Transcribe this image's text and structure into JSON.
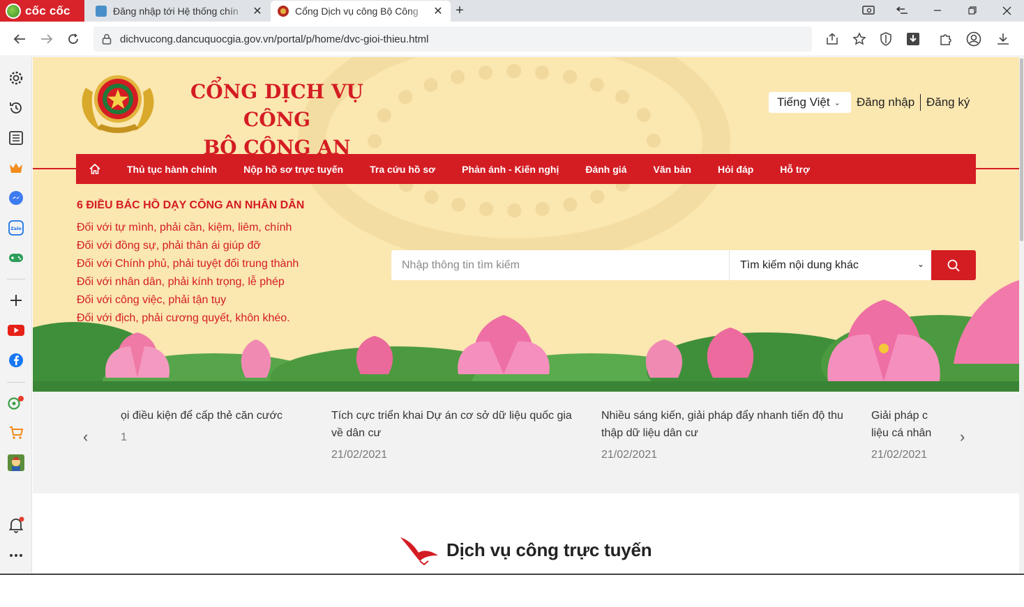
{
  "browser": {
    "brand": "cốc cốc",
    "tabs": [
      {
        "title": "Đăng nhập tới Hệ thống chín"
      },
      {
        "title": "Cổng Dịch vụ công Bộ Công"
      }
    ],
    "url": "dichvucong.dancuquocgia.gov.vn/portal/p/home/dvc-gioi-thieu.html"
  },
  "header": {
    "title_line1": "CỔNG DỊCH VỤ CÔNG",
    "title_line2": "BỘ CÔNG AN",
    "language": "Tiếng Việt",
    "login": "Đăng nhập",
    "register": "Đăng ký"
  },
  "menu": {
    "items": [
      "Thủ tục hành chính",
      "Nộp hồ sơ trực tuyến",
      "Tra cứu hồ sơ",
      "Phản ánh - Kiến nghị",
      "Đánh giá",
      "Văn bản",
      "Hỏi đáp",
      "Hỗ trợ"
    ]
  },
  "teachings": {
    "title": "6 ĐIỀU BÁC HỒ DẠY CÔNG AN NHÂN DÂN",
    "lines": [
      "Đối với tự mình, phải cần, kiệm, liêm, chính",
      "Đối với đồng sự, phải thân ái giúp đỡ",
      "Đối với Chính phủ, phải tuyệt đối trung thành",
      "Đối với nhân dân, phải kính trọng, lễ phép",
      "Đối với công việc, phải tận tụy",
      "Đối với địch, phải cương quyết, khôn khéo."
    ]
  },
  "search": {
    "placeholder": "Nhập thông tin tìm kiếm",
    "scope": "Tìm kiếm nội dung khác"
  },
  "news": {
    "items": [
      {
        "title": "ọi điều kiện để cấp thẻ căn cước",
        "date": "1"
      },
      {
        "title": "Tích cực triển khai Dự án cơ sở dữ liệu quốc gia về dân cư",
        "date": "21/02/2021"
      },
      {
        "title": "Nhiều sáng kiến, giải pháp đẩy nhanh tiến độ thu thập dữ liệu dân cư",
        "date": "21/02/2021"
      },
      {
        "title": "Giải pháp c liệu cá nhân",
        "date": "21/02/2021"
      }
    ]
  },
  "section": {
    "title": "Dịch vụ công trực tuyến"
  },
  "colors": {
    "brand_red": "#d41c23",
    "hero_bg": "#fbe7b0",
    "news_bg": "#f2f2f2"
  }
}
